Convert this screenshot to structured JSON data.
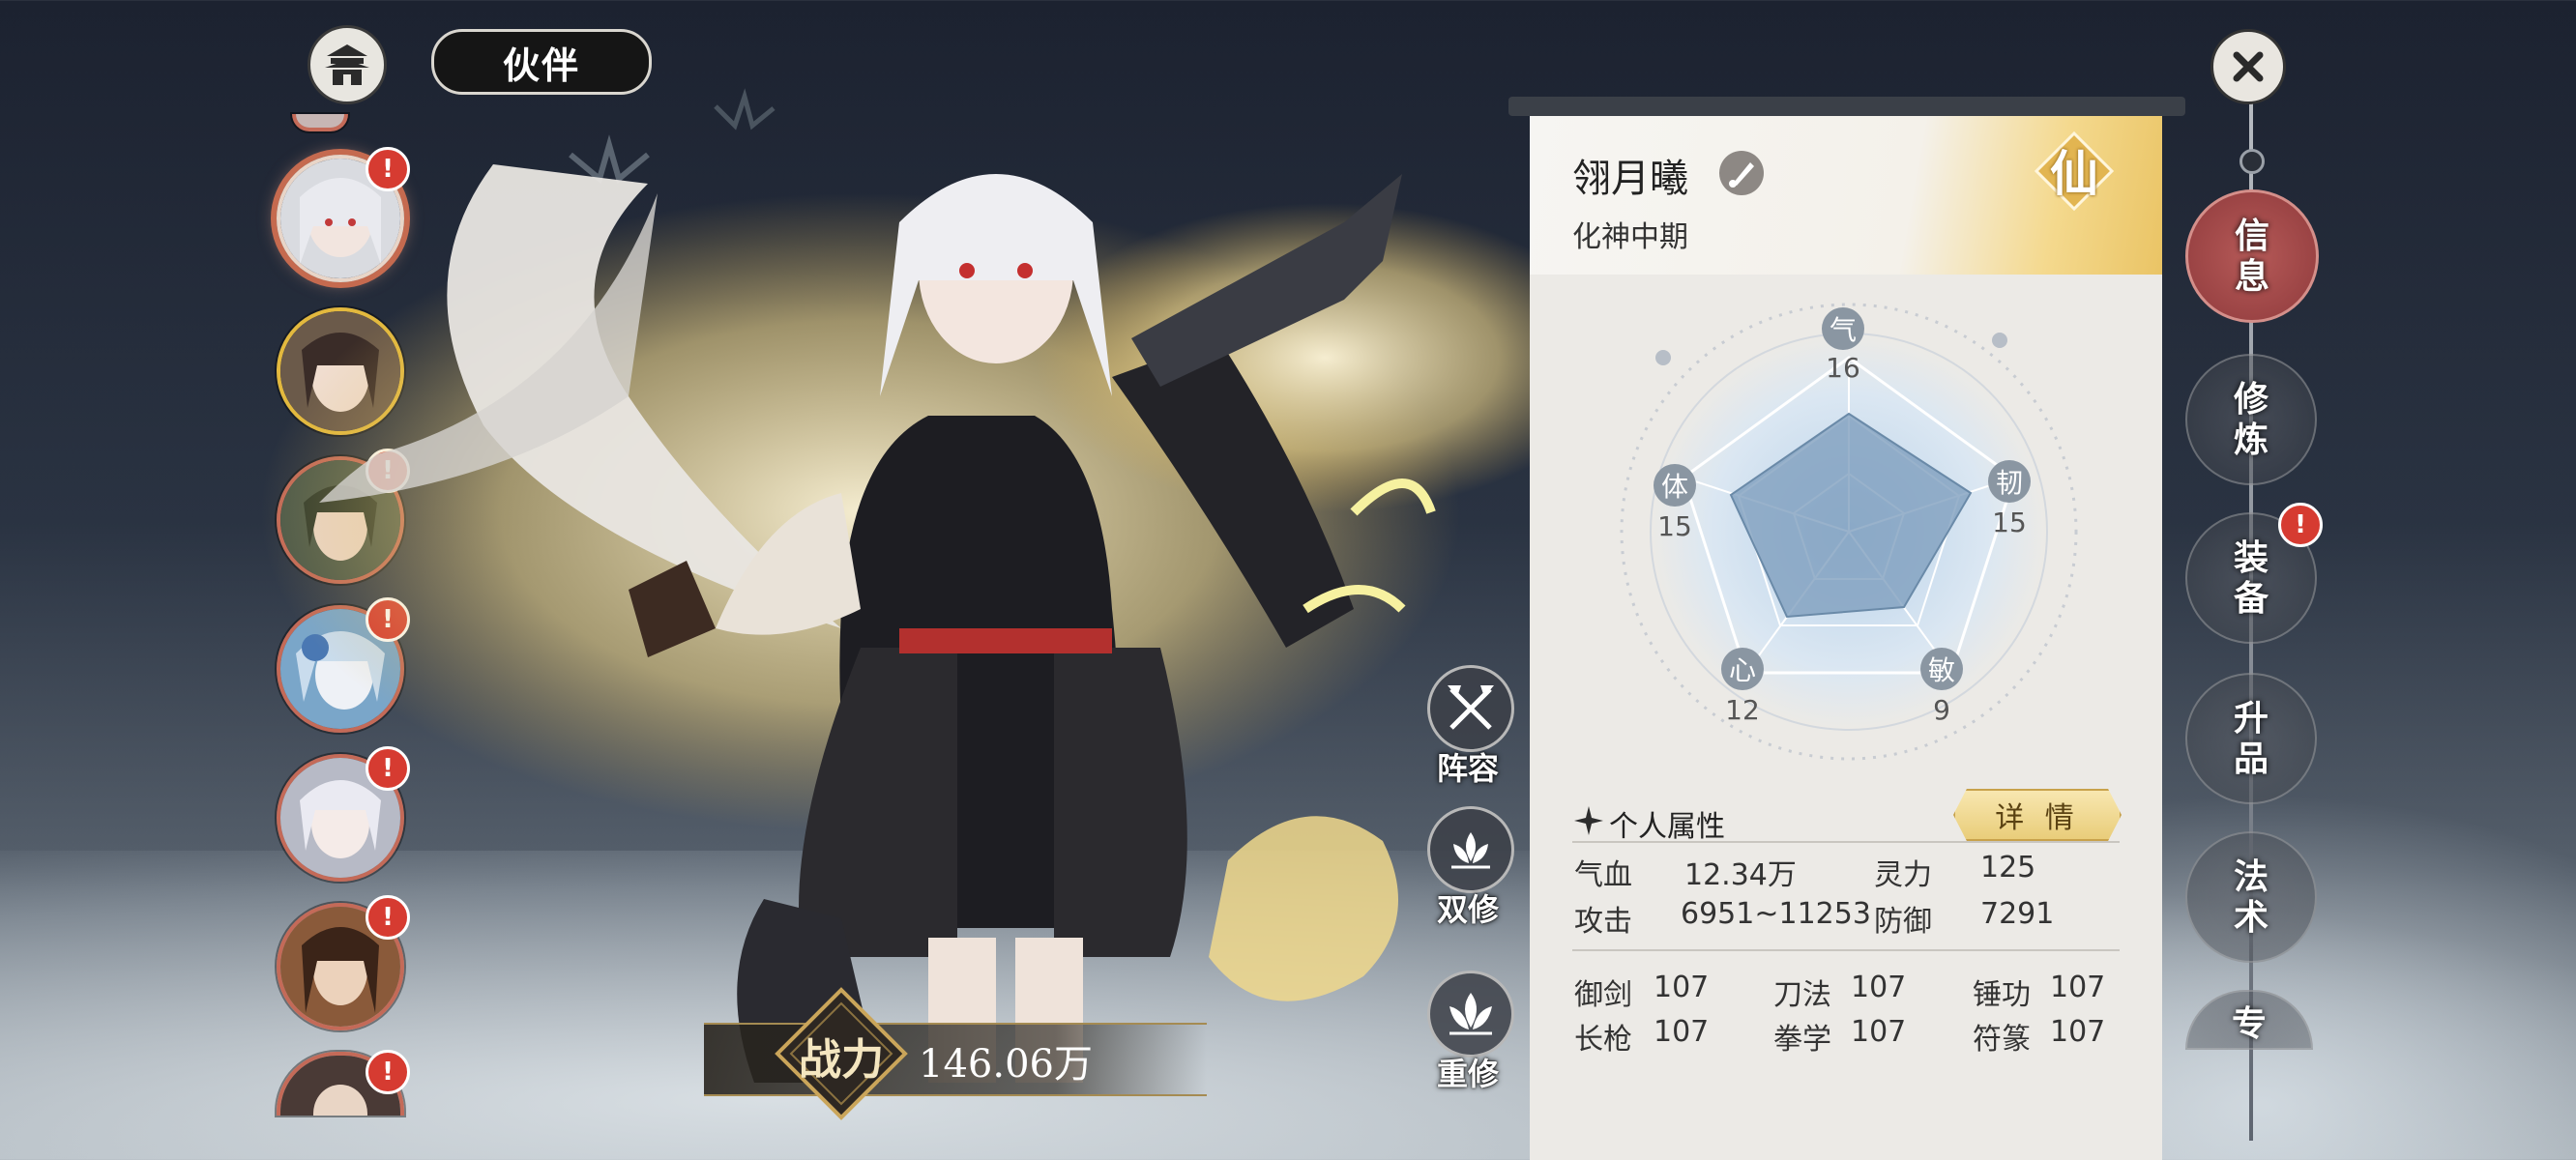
{
  "header": {
    "title": "伙伴",
    "home_icon": "palace-icon"
  },
  "partners": [
    {
      "name": "partner-1",
      "badge": "!",
      "selected": true,
      "ring": "selected"
    },
    {
      "name": "partner-2",
      "badge": "",
      "ring": "gold"
    },
    {
      "name": "partner-3",
      "badge": "!",
      "ring": "red"
    },
    {
      "name": "partner-4",
      "badge": "!",
      "ring": "red"
    },
    {
      "name": "partner-5",
      "badge": "!",
      "ring": "red"
    },
    {
      "name": "partner-6",
      "badge": "!",
      "ring": "red"
    },
    {
      "name": "partner-7",
      "badge": "!",
      "ring": "red"
    }
  ],
  "power": {
    "label": "战力",
    "value": "146.06万"
  },
  "actions": [
    {
      "label": "阵容",
      "icon": "crossed-axes-icon"
    },
    {
      "label": "双修",
      "icon": "lotus-pair-icon"
    },
    {
      "label": "重修",
      "icon": "lotus-icon"
    }
  ],
  "character": {
    "name": "翎月曦",
    "realm": "化神中期",
    "tag": "仙"
  },
  "radar": {
    "qi": {
      "label": "气",
      "value": "16"
    },
    "ren": {
      "label": "韧",
      "value": "15"
    },
    "min": {
      "label": "敏",
      "value": "9"
    },
    "xin": {
      "label": "心",
      "value": "12"
    },
    "ti": {
      "label": "体",
      "value": "15"
    }
  },
  "attributes": {
    "title": "个人属性",
    "detail_button": "详 情",
    "qixue_label": "气血",
    "qixue_value": "12.34万",
    "lingli_label": "灵力",
    "lingli_value": "125",
    "gongji_label": "攻击",
    "gongji_value": "6951~11253",
    "fangyu_label": "防御",
    "fangyu_value": "7291",
    "skills": [
      {
        "label": "御剑",
        "value": "107"
      },
      {
        "label": "刀法",
        "value": "107"
      },
      {
        "label": "锤功",
        "value": "107"
      },
      {
        "label": "长枪",
        "value": "107"
      },
      {
        "label": "拳学",
        "value": "107"
      },
      {
        "label": "符篆",
        "value": "107"
      }
    ]
  },
  "tabs": [
    {
      "line1": "信",
      "line2": "息",
      "active": true
    },
    {
      "line1": "修",
      "line2": "炼",
      "active": false
    },
    {
      "line1": "装",
      "line2": "备",
      "active": false,
      "badge": "!"
    },
    {
      "line1": "升",
      "line2": "品",
      "active": false
    },
    {
      "line1": "法",
      "line2": "术",
      "active": false
    },
    {
      "line1": "专",
      "line2": "",
      "active": false
    }
  ],
  "colors": {
    "accent_red": "#b65a58",
    "gold": "#e9cd7a",
    "badge_red": "#d63b31"
  }
}
